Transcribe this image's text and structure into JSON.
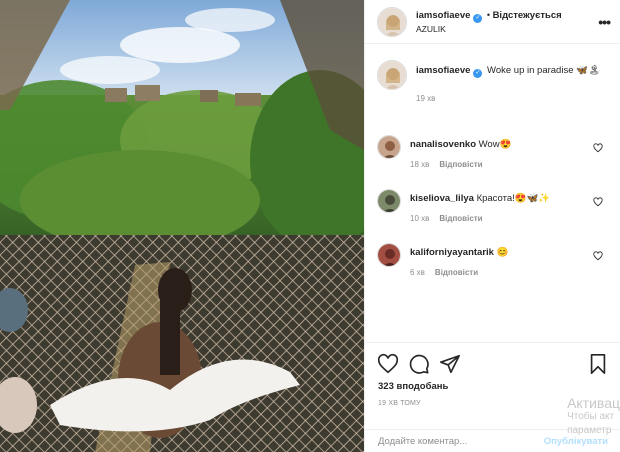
{
  "post": {
    "username": "iamsofiaeve",
    "follow_status": "Відстежується",
    "location": "AZULIK",
    "more_icon": "more-dots-icon"
  },
  "caption": {
    "username": "iamsofiaeve",
    "text": "Woke up in paradise 🦋🏝",
    "time": "19 хв"
  },
  "comments": [
    {
      "username": "nanalisovenko",
      "text": "Wow😍",
      "time": "18 хв",
      "reply": "Відповісти"
    },
    {
      "username": "kiseliova_lilya",
      "text": "Красота!😍🦋✨",
      "time": "10 хв",
      "reply": "Відповісти"
    },
    {
      "username": "kaliforniyayantarik",
      "text": "😊",
      "time": "6 хв",
      "reply": "Відповісти"
    }
  ],
  "actions": {
    "icons": [
      "heart-icon",
      "comment-icon",
      "share-icon",
      "bookmark-icon"
    ],
    "likes": "323 вподобань",
    "posted_ago": "19 хв тому"
  },
  "add_comment": {
    "placeholder": "Додайте коментар...",
    "publish_label": "Опублікувати"
  },
  "watermark": {
    "line1": "Активац",
    "line2": "Чтобы акт",
    "line3": "параметр"
  },
  "colors": {
    "verified": "#3897f0",
    "publish_disabled": "#b2dffc",
    "muted": "#8e8e8e"
  }
}
